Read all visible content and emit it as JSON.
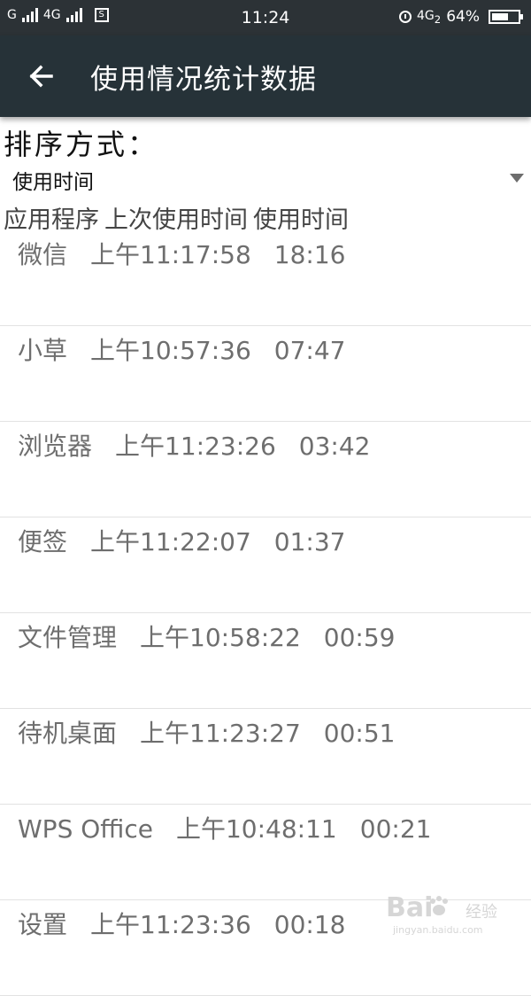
{
  "status_bar": {
    "carrier_left": "G",
    "network_type": "4G",
    "time": "11:24",
    "network_right": "4G",
    "network_right_sub": "2",
    "battery_text": "64%",
    "battery_level": 0.64
  },
  "app_bar": {
    "title": "使用情况统计数据"
  },
  "sort": {
    "label": "排序方式：",
    "selected": "使用时间"
  },
  "columns": [
    "应用程序",
    "上次使用时间",
    "使用时间"
  ],
  "rows": [
    {
      "app": "微信",
      "last_used": "上午11:17:58",
      "usage": "18:16"
    },
    {
      "app": "小草",
      "last_used": "上午10:57:36",
      "usage": "07:47"
    },
    {
      "app": "浏览器",
      "last_used": "上午11:23:26",
      "usage": "03:42"
    },
    {
      "app": "便签",
      "last_used": "上午11:22:07",
      "usage": "01:37"
    },
    {
      "app": "文件管理",
      "last_used": "上午10:58:22",
      "usage": "00:59"
    },
    {
      "app": "待机桌面",
      "last_used": "上午11:23:27",
      "usage": "00:51"
    },
    {
      "app": "WPS Office",
      "last_used": "上午10:48:11",
      "usage": "00:21"
    },
    {
      "app": "设置",
      "last_used": "上午11:23:36",
      "usage": "00:18"
    }
  ],
  "watermark": {
    "brand": "Bai",
    "brand_suffix": "经验",
    "url": "jingyan.baidu.com"
  },
  "colors": {
    "app_bar": "#263238",
    "status_bar": "#2c3236",
    "row_text": "#6e6e6e"
  }
}
